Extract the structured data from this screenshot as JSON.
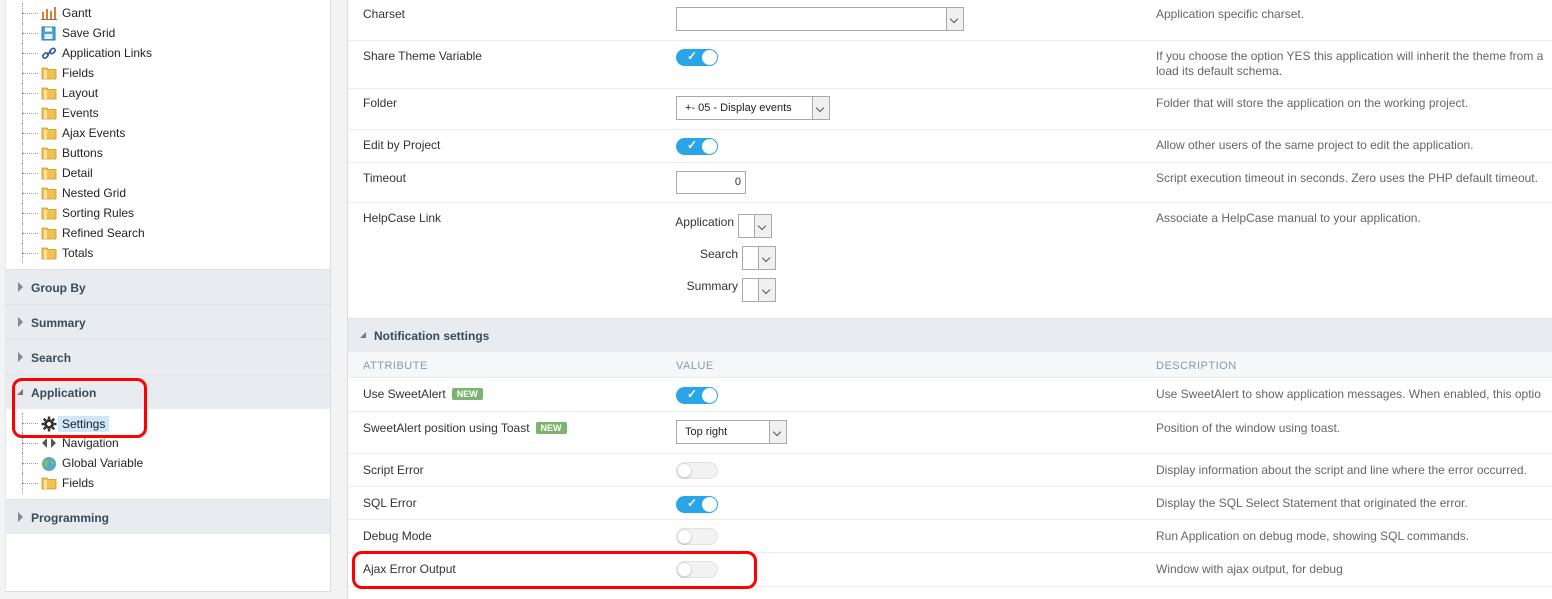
{
  "sidebar": {
    "tree_top": [
      {
        "label": "Gantt",
        "icon": "bar-chart-icon"
      },
      {
        "label": "Save Grid",
        "icon": "save-icon"
      },
      {
        "label": "Application Links",
        "icon": "link-icon"
      },
      {
        "label": "Fields",
        "icon": "folder-icon"
      },
      {
        "label": "Layout",
        "icon": "folder-icon"
      },
      {
        "label": "Events",
        "icon": "folder-icon"
      },
      {
        "label": "Ajax Events",
        "icon": "folder-icon"
      },
      {
        "label": "Buttons",
        "icon": "folder-icon"
      },
      {
        "label": "Detail",
        "icon": "folder-icon"
      },
      {
        "label": "Nested Grid",
        "icon": "folder-icon"
      },
      {
        "label": "Sorting Rules",
        "icon": "folder-icon"
      },
      {
        "label": "Refined Search",
        "icon": "folder-icon"
      },
      {
        "label": "Totals",
        "icon": "folder-icon"
      }
    ],
    "groups": {
      "group_by": "Group By",
      "summary": "Summary",
      "search": "Search",
      "application": "Application",
      "programming": "Programming"
    },
    "application_items": [
      {
        "label": "Settings",
        "icon": "gear-icon",
        "selected": true
      },
      {
        "label": "Navigation",
        "icon": "navigation-arrows-icon"
      },
      {
        "label": "Global Variable",
        "icon": "globe-icon"
      },
      {
        "label": "Fields",
        "icon": "folder-icon"
      }
    ]
  },
  "main": {
    "charset": {
      "attr": "Charset",
      "value": "",
      "desc": "Application specific charset."
    },
    "share_theme": {
      "attr": "Share Theme Variable",
      "on": true,
      "desc_line1": "If you choose the option YES this application will inherit the theme from a",
      "desc_line2": "load its default schema."
    },
    "folder": {
      "attr": "Folder",
      "value": "+- 05 - Display events",
      "desc": "Folder that will store the application on the working project."
    },
    "edit_by_project": {
      "attr": "Edit by Project",
      "on": true,
      "desc": "Allow other users of the same project to edit the application."
    },
    "timeout": {
      "attr": "Timeout",
      "value": "0",
      "desc": "Script execution timeout in seconds. Zero uses the PHP default timeout."
    },
    "helpcase": {
      "attr": "HelpCase Link",
      "desc": "Associate a HelpCase manual to your application.",
      "fields": [
        "Application",
        "Search",
        "Summary"
      ]
    },
    "notification_section": "Notification settings",
    "columns": {
      "attribute": "ATTRIBUTE",
      "value": "VALUE",
      "description": "DESCRIPTION"
    },
    "new_badge": "NEW",
    "sweetalert": {
      "attr": "Use SweetAlert",
      "on": true,
      "desc": "Use SweetAlert to show application messages. When enabled, this optio"
    },
    "toast": {
      "attr": "SweetAlert position using Toast",
      "value": "Top right",
      "desc": "Position of the window using toast."
    },
    "script_error": {
      "attr": "Script Error",
      "on": false,
      "desc": "Display information about the script and line where the error occurred."
    },
    "sql_error": {
      "attr": "SQL Error",
      "on": true,
      "desc": "Display the SQL Select Statement that originated the error."
    },
    "debug_mode": {
      "attr": "Debug Mode",
      "on": false,
      "desc": "Run Application on debug mode, showing SQL commands."
    },
    "ajax_error": {
      "attr": "Ajax Error Output",
      "on": false,
      "desc": "Window with ajax output, for debug"
    },
    "check_glyph": "✓"
  },
  "colors": {
    "accent": "#2aa6e8",
    "badge": "#7cb46f",
    "highlight": "#ff0000",
    "selected": "#cde8fa"
  }
}
